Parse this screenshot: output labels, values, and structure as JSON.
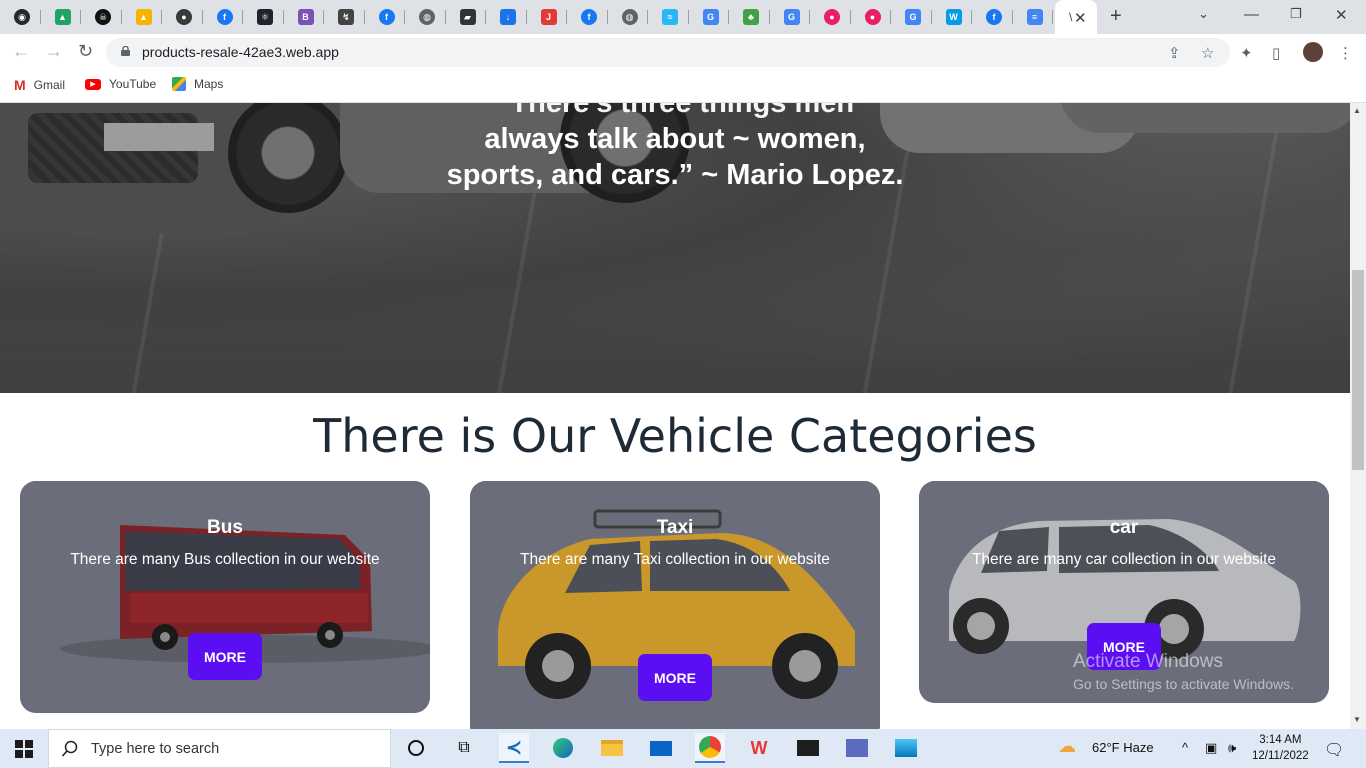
{
  "browser": {
    "url": "products-resale-42ae3.web.app",
    "bookmarks": [
      {
        "label": "Gmail",
        "icon": "gmail-icon",
        "color": "#d93025"
      },
      {
        "label": "YouTube",
        "icon": "youtube-icon",
        "color": "#ff0000"
      },
      {
        "label": "Maps",
        "icon": "maps-icon",
        "color": "#34a853"
      }
    ],
    "active_tab_glyph": "\\",
    "tab_favicons": [
      {
        "icon": "github-icon",
        "color": "#24292e",
        "glyph": "◉"
      },
      {
        "icon": "google-drive-icon",
        "color": "#1fa463",
        "glyph": "▲"
      },
      {
        "icon": "pirate-icon",
        "color": "#111111",
        "glyph": "☠"
      },
      {
        "icon": "google-drive-icon",
        "color": "#f4b400",
        "glyph": "▲"
      },
      {
        "icon": "app-icon",
        "color": "#3a3a3a",
        "glyph": "●"
      },
      {
        "icon": "facebook-icon",
        "color": "#1877f2",
        "glyph": "f"
      },
      {
        "icon": "react-icon",
        "color": "#20232a",
        "glyph": "⚛"
      },
      {
        "icon": "bootstrap-icon",
        "color": "#7952b3",
        "glyph": "B"
      },
      {
        "icon": "arrow-icon",
        "color": "#444444",
        "glyph": "↯"
      },
      {
        "icon": "facebook-icon",
        "color": "#1877f2",
        "glyph": "f"
      },
      {
        "icon": "globe-icon",
        "color": "#5f6368",
        "glyph": "◍"
      },
      {
        "icon": "graduation-icon",
        "color": "#333333",
        "glyph": "▰"
      },
      {
        "icon": "download-icon",
        "color": "#1a73e8",
        "glyph": "↓"
      },
      {
        "icon": "jpg-png-icon",
        "color": "#e53935",
        "glyph": "J"
      },
      {
        "icon": "facebook-icon",
        "color": "#1877f2",
        "glyph": "f"
      },
      {
        "icon": "globe-icon",
        "color": "#5f6368",
        "glyph": "◍"
      },
      {
        "icon": "wave-icon",
        "color": "#29b6f6",
        "glyph": "≈"
      },
      {
        "icon": "google-icon",
        "color": "#4285f4",
        "glyph": "G"
      },
      {
        "icon": "plant-icon",
        "color": "#43a047",
        "glyph": "♣"
      },
      {
        "icon": "google-icon",
        "color": "#4285f4",
        "glyph": "G"
      },
      {
        "icon": "drop-icon",
        "color": "#e91e63",
        "glyph": "●"
      },
      {
        "icon": "drop-icon",
        "color": "#e91e63",
        "glyph": "●"
      },
      {
        "icon": "google-icon",
        "color": "#4285f4",
        "glyph": "G"
      },
      {
        "icon": "w-icon",
        "color": "#039be5",
        "glyph": "W"
      },
      {
        "icon": "facebook-icon",
        "color": "#1877f2",
        "glyph": "f"
      },
      {
        "icon": "docs-icon",
        "color": "#4285f4",
        "glyph": "≡"
      }
    ]
  },
  "hero": {
    "quote_partial_line": "“There's three things men",
    "quote_line2": "always talk about ~ women,",
    "quote_line3": "sports, and cars.” ~ Mario Lopez."
  },
  "categories_title": "There is Our Vehicle Categories",
  "categories": [
    {
      "name": "Bus",
      "description": "There are many Bus collection in our website",
      "button": "MORE"
    },
    {
      "name": "Taxi",
      "description": "There are many Taxi collection in our website",
      "button": "MORE"
    },
    {
      "name": "car",
      "description": "There are many car collection in our website",
      "button": "MORE"
    }
  ],
  "watermark": {
    "line1": "Activate Windows",
    "line2": "Go to Settings to activate Windows."
  },
  "taskbar": {
    "search_placeholder": "Type here to search",
    "weather": "62°F  Haze",
    "time": "3:14 AM",
    "date": "12/11/2022"
  },
  "colors": {
    "more_button": "#5b0ef2",
    "card_overlay": "#6b6e7a",
    "title_text": "#1f2a37"
  }
}
